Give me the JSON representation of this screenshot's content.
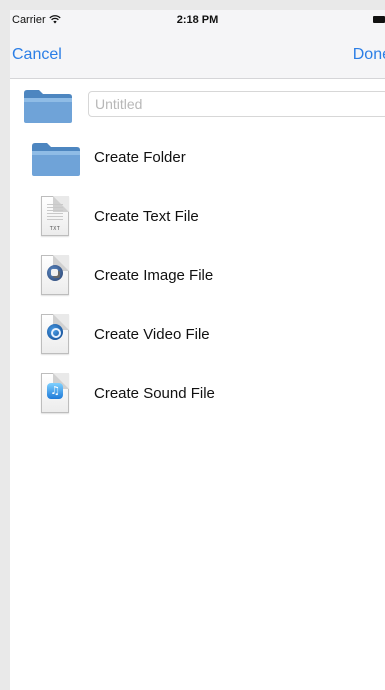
{
  "status_bar": {
    "carrier": "Carrier",
    "time": "2:18 PM"
  },
  "nav": {
    "cancel_label": "Cancel",
    "done_label": "Done"
  },
  "name_field": {
    "placeholder": "Untitled",
    "value": ""
  },
  "items": [
    {
      "label": "Create Folder",
      "icon": "folder-icon"
    },
    {
      "label": "Create Text File",
      "icon": "text-file-icon",
      "tag": "TXT"
    },
    {
      "label": "Create Image File",
      "icon": "image-file-icon"
    },
    {
      "label": "Create Video File",
      "icon": "video-file-icon"
    },
    {
      "label": "Create Sound File",
      "icon": "sound-file-icon"
    }
  ],
  "colors": {
    "accent": "#2b7ee6",
    "folder": "#6fa3d8",
    "nav_background": "#f5f5f7"
  }
}
